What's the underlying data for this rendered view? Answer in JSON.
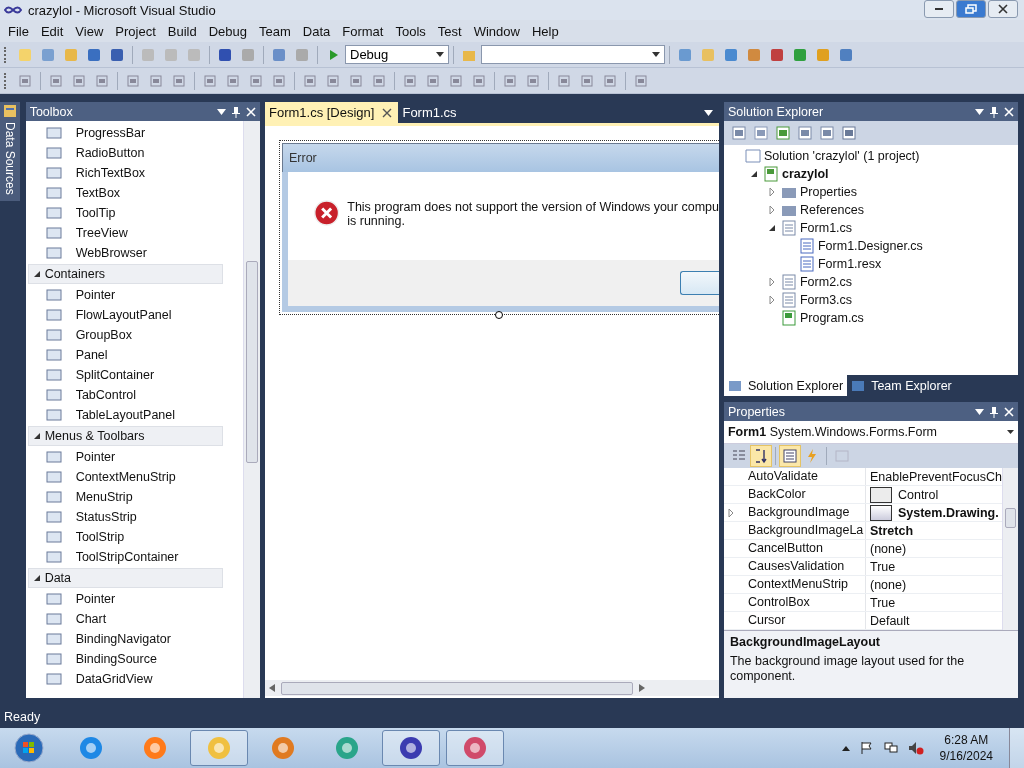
{
  "window": {
    "title": "crazylol - Microsoft Visual Studio"
  },
  "menu": [
    "File",
    "Edit",
    "View",
    "Project",
    "Build",
    "Debug",
    "Team",
    "Data",
    "Format",
    "Tools",
    "Test",
    "Window",
    "Help"
  ],
  "toolbar": {
    "configuration": "Debug"
  },
  "side_tab": {
    "label": "Data Sources"
  },
  "toolbox": {
    "title": "Toolbox",
    "items": [
      "ProgressBar",
      "RadioButton",
      "RichTextBox",
      "TextBox",
      "ToolTip",
      "TreeView",
      "WebBrowser"
    ],
    "groups": [
      {
        "label": "Containers",
        "expanded": true,
        "items": [
          "Pointer",
          "FlowLayoutPanel",
          "GroupBox",
          "Panel",
          "SplitContainer",
          "TabControl",
          "TableLayoutPanel"
        ]
      },
      {
        "label": "Menus & Toolbars",
        "expanded": true,
        "items": [
          "Pointer",
          "ContextMenuStrip",
          "MenuStrip",
          "StatusStrip",
          "ToolStrip",
          "ToolStripContainer"
        ]
      },
      {
        "label": "Data",
        "expanded": true,
        "items": [
          "Pointer",
          "Chart",
          "BindingNavigator",
          "BindingSource",
          "DataGridView"
        ]
      }
    ]
  },
  "editor": {
    "tabs": [
      {
        "label": "Form1.cs [Design]",
        "selected": true
      },
      {
        "label": "Form1.cs",
        "selected": false
      }
    ],
    "form": {
      "title": "Error",
      "message_lines": [
        "This program does not support the version of Windows your compu",
        "is running."
      ]
    }
  },
  "solution_explorer": {
    "title": "Solution Explorer",
    "tree": [
      {
        "label": "Solution 'crazylol' (1 project)",
        "kind": "solution",
        "children": [
          {
            "label": "crazylol",
            "kind": "project",
            "expanded": true,
            "children": [
              {
                "label": "Properties",
                "kind": "folder",
                "expanded": false
              },
              {
                "label": "References",
                "kind": "folder",
                "expanded": false
              },
              {
                "label": "Form1.cs",
                "kind": "form",
                "expanded": true,
                "children": [
                  {
                    "label": "Form1.Designer.cs",
                    "kind": "file"
                  },
                  {
                    "label": "Form1.resx",
                    "kind": "file"
                  }
                ]
              },
              {
                "label": "Form2.cs",
                "kind": "form",
                "expanded": false
              },
              {
                "label": "Form3.cs",
                "kind": "form",
                "expanded": false
              },
              {
                "label": "Program.cs",
                "kind": "code"
              }
            ]
          }
        ]
      }
    ],
    "tabs": [
      {
        "label": "Solution Explorer",
        "selected": true
      },
      {
        "label": "Team Explorer",
        "selected": false
      }
    ]
  },
  "properties": {
    "title": "Properties",
    "object_name": "Form1",
    "object_type": "System.Windows.Forms.Form",
    "sort_buttons": [
      {
        "selected": false
      },
      {
        "selected": true
      }
    ],
    "view_buttons": [
      {
        "selected": true
      },
      {
        "selected": false
      }
    ],
    "rows": [
      {
        "name": "AutoValidate",
        "value": "EnablePreventFocusCh",
        "kind": "text",
        "modified": false
      },
      {
        "name": "BackColor",
        "value": "Control",
        "kind": "color",
        "modified": false
      },
      {
        "name": "BackgroundImage",
        "value": "System.Drawing.",
        "kind": "image",
        "modified": true,
        "expanded": false
      },
      {
        "name": "BackgroundImageLa",
        "value": "Stretch",
        "kind": "text",
        "modified": true
      },
      {
        "name": "CancelButton",
        "value": "(none)",
        "kind": "text",
        "modified": false
      },
      {
        "name": "CausesValidation",
        "value": "True",
        "kind": "text",
        "modified": false
      },
      {
        "name": "ContextMenuStrip",
        "value": "(none)",
        "kind": "text",
        "modified": false
      },
      {
        "name": "ControlBox",
        "value": "True",
        "kind": "text",
        "modified": false
      },
      {
        "name": "Cursor",
        "value": "Default",
        "kind": "text",
        "modified": false
      }
    ],
    "description": {
      "title": "BackgroundImageLayout",
      "text": "The background image layout used for the component."
    }
  },
  "status_bar": {
    "text": "Ready"
  },
  "taskbar": {
    "apps": [
      {
        "open": false
      },
      {
        "open": false
      },
      {
        "open": true
      },
      {
        "open": false
      },
      {
        "open": false
      },
      {
        "open": true
      },
      {
        "open": true
      }
    ],
    "time": "6:28 AM",
    "date": "9/16/2024"
  }
}
